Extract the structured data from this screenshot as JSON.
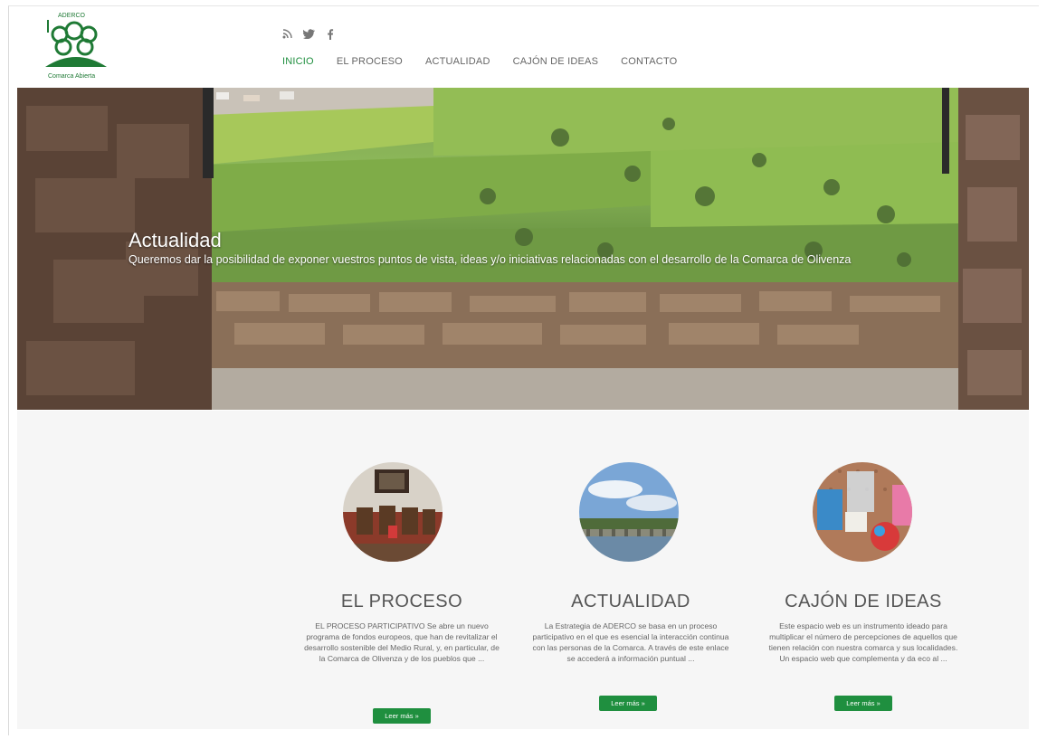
{
  "brand": {
    "top_text": "ADERCO",
    "caption": "Comarca Abierta",
    "color": "#1f7a35"
  },
  "social_icons": [
    "rss-icon",
    "twitter-icon",
    "facebook-icon"
  ],
  "nav": [
    {
      "label": "INICIO",
      "active": true
    },
    {
      "label": "EL PROCESO",
      "active": false
    },
    {
      "label": "ACTUALIDAD",
      "active": false
    },
    {
      "label": "CAJÓN DE IDEAS",
      "active": false
    },
    {
      "label": "CONTACTO",
      "active": false
    }
  ],
  "hero": {
    "title": "Actualidad",
    "subtitle": "Queremos dar la posibilidad de exponer vuestros puntos de vista, ideas y/o iniciativas relacionadas con el desarrollo de la Comarca de Olivenza"
  },
  "features": [
    {
      "title": "EL PROCESO",
      "text": "EL PROCESO PARTICIPATIVO Se abre un nuevo programa de fondos europeos, que han de revitalizar el desarrollo sostenible del Medio Rural, y, en particular, de la Comarca de Olivenza y de los pueblos que ...",
      "button": "Leer más »"
    },
    {
      "title": "ACTUALIDAD",
      "text": "La Estrategia de ADERCO se basa en un proceso participativo en el que es esencial la interacción continua con las personas de la Comarca. A través de este enlace se accederá a información puntual ...",
      "button": "Leer más »"
    },
    {
      "title": "CAJÓN DE IDEAS",
      "text": "Este espacio web es un instrumento ideado para multiplicar el número de percepciones de aquellos que tienen relación con nuestra comarca y sus localidades. Un espacio web que complementa y da eco al ...",
      "button": "Leer más »"
    }
  ],
  "colors": {
    "accent": "#1f8f3f",
    "nav_text": "#666666"
  }
}
